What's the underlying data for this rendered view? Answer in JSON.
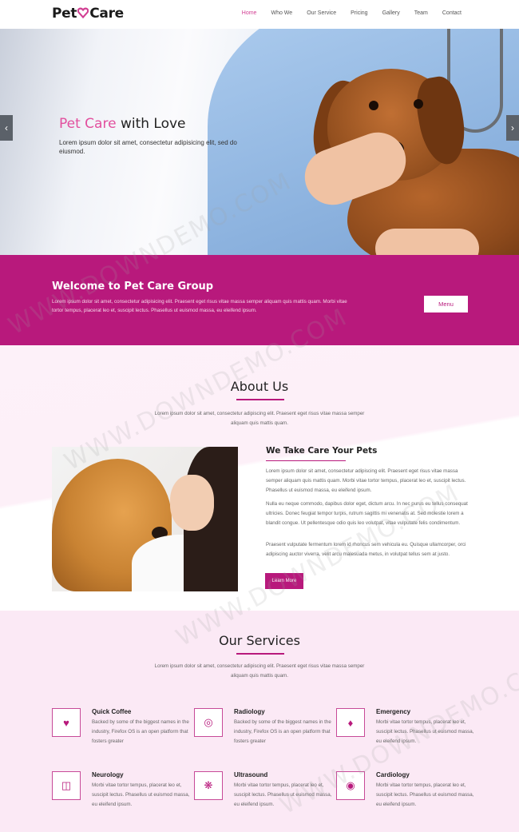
{
  "brand": {
    "name_part1": "Pet",
    "name_part2": "Care",
    "accent": "#b8197c",
    "pink": "#e24f9e"
  },
  "nav": {
    "items": [
      "Home",
      "Who We",
      "Our Service",
      "Pricing",
      "Gallery",
      "Team",
      "Contact"
    ],
    "active": "Home"
  },
  "hero": {
    "title_pink": "Pet Care",
    "title_rest": " with Love",
    "subtitle": "Lorem ipsum dolor sit amet, consectetur adipisicing elit, sed do eiusmod.",
    "prev_icon": "chevron-left-icon",
    "next_icon": "chevron-right-icon"
  },
  "welcome": {
    "title": "Welcome to Pet Care Group",
    "text": "Lorem ipsum dolor sit amet, consectetur adipisicing elit. Praesent eget risus vitae massa semper aliquam quis mattis quam. Morbi vitae tortor tempus, placerat leo et, suscipit lectus. Phasellus ut euismod massa, eu eleifend ipsum.",
    "button": "Menu"
  },
  "about": {
    "title": "About Us",
    "subtitle": "Lorem ipsum dolor sit amet, consectetur adipiscing elit. Praesent eget risus vitae massa semper aliquam quis mattis quam.",
    "heading": "We Take Care Your Pets",
    "p1": "Lorem ipsum dolor sit amet, consectetur adipiscing elit. Praesent eget risus vitae massa semper aliquam quis mattis quam. Morbi vitae tortor tempus, placerat leo et, suscipit lectus. Phasellus ut euismod massa, eu eleifend ipsum.",
    "p2": "Nulla eu neque commodo, dapibus dolor eget, dictum arcu. In nec purus eu tellus consequat ultricies. Donec feugiat tempor turpis, rutrum sagittis mi venenatis at. Sed molestie lorem a blandit congue. Ut pellentesque odio quis leo volutpat, vitae vulputate felis condimentum.",
    "p3": "Praesent vulputate fermentum lorem id rhoncus sem vehicula eu. Quisque ullamcorper, orci adipiscing auctor viverra, velit arcu malesuada metus, in volutpat tellus sem at justo.",
    "button": "Learn More"
  },
  "services": {
    "title": "Our Services",
    "subtitle": "Lorem ipsum dolor sit amet, consectetur adipiscing elit. Praesent eget risus vitae massa semper aliquam quis mattis quam.",
    "items": [
      {
        "title": "Quick Coffee",
        "text": "Backed by some of the biggest names in the industry, Firefox OS is an open platform that fosters greater",
        "icon": "heart-icon"
      },
      {
        "title": "Radiology",
        "text": "Backed by some of the biggest names in the industry, Firefox OS is an open platform that fosters greater",
        "icon": "target-icon"
      },
      {
        "title": "Emergency",
        "text": "Morbi vitae tortor tempus, placerat leo et, suscipit lectus. Phasellus ut euismod massa, eu eleifend ipsum.",
        "icon": "bell-icon"
      },
      {
        "title": "Neurology",
        "text": "Morbi vitae tortor tempus, placerat leo et, suscipit lectus. Phasellus ut euismod massa, eu eleifend ipsum.",
        "icon": "cube-icon"
      },
      {
        "title": "Ultrasound",
        "text": "Morbi vitae tortor tempus, placerat leo et, suscipit lectus. Phasellus ut euismod massa, eu eleifend ipsum.",
        "icon": "yelp-icon"
      },
      {
        "title": "Cardiology",
        "text": "Morbi vitae tortor tempus, placerat leo et, suscipit lectus. Phasellus ut euismod massa, eu eleifend ipsum.",
        "icon": "lifebuoy-icon"
      }
    ]
  },
  "watermark": "WWW.DOWNDEMO.COM"
}
